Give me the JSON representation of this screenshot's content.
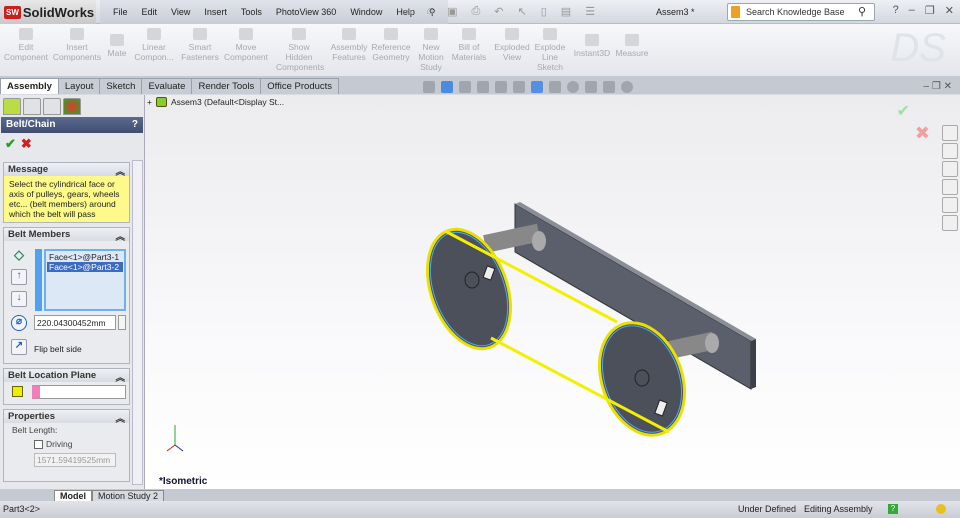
{
  "app": {
    "name": "SolidWorks",
    "logo_badge": "SW",
    "document_title": "Assem3 *"
  },
  "menu": [
    "File",
    "Edit",
    "View",
    "Insert",
    "Tools",
    "PhotoView 360",
    "Window",
    "Help"
  ],
  "search": {
    "placeholder": "Search Knowledge Base"
  },
  "ribbon": [
    {
      "label": "Edit Component"
    },
    {
      "label": "Insert Components"
    },
    {
      "label": "Mate"
    },
    {
      "label": "Linear Compon..."
    },
    {
      "label": "Smart Fasteners"
    },
    {
      "label": "Move Component"
    },
    {
      "label": "Show Hidden Components"
    },
    {
      "label": "Assembly Features"
    },
    {
      "label": "Reference Geometry"
    },
    {
      "label": "New Motion Study"
    },
    {
      "label": "Bill of Materials"
    },
    {
      "label": "Exploded View"
    },
    {
      "label": "Explode Line Sketch"
    },
    {
      "label": "Instant3D"
    },
    {
      "label": "Measure"
    }
  ],
  "tabs": [
    "Assembly",
    "Layout",
    "Sketch",
    "Evaluate",
    "Render Tools",
    "Office Products"
  ],
  "property_manager": {
    "title": "Belt/Chain",
    "help": "?",
    "message_header": "Message",
    "message": "Select the cylindrical face or axis of pulleys, gears, wheels etc... (belt members) around which the belt will pass",
    "belt_members_header": "Belt Members",
    "members": [
      "Face<1>@Part3-1",
      "Face<1>@Part3-2"
    ],
    "diameter": "220.04300452mm",
    "flip_label": "Flip belt side",
    "plane_header": "Belt Location Plane",
    "properties_header": "Properties",
    "belt_length_label": "Belt Length:",
    "driving_label": "Driving",
    "belt_length": "1571.59419525mm"
  },
  "tree": {
    "root": "Assem3  (Default<Display St..."
  },
  "view": {
    "orientation": "*Isometric"
  },
  "bottom_tabs": [
    "Model",
    "Motion Study 2"
  ],
  "status": {
    "selection": "Part3<2>",
    "state": "Under Defined",
    "mode": "Editing Assembly"
  }
}
